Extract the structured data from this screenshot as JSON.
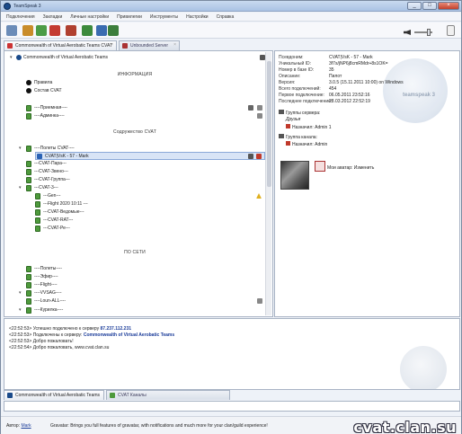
{
  "window": {
    "title": "TeamSpeak 3"
  },
  "menu": [
    "Подключения",
    "Закладки",
    "Личные настройки",
    "Привилегии",
    "Инструменты",
    "Настройки",
    "Справка"
  ],
  "tabs_top": [
    {
      "label": "Commonwealth of Virtual Aerobatic Teams  CVAT",
      "active": true
    },
    {
      "label": "Unbounded Server",
      "active": false
    }
  ],
  "tree": {
    "server": "Commonwealth of Virtual Aerobatic Teams",
    "sec_info": "ИНФОРМАЦИЯ",
    "info_items": [
      "Правила",
      "Состав CVAT"
    ],
    "channels_a": [
      "----Приемная----",
      "----Админка----"
    ],
    "sec_cvat": "Содружество CVAT",
    "channels_b": [
      "----Полеты CVAT----"
    ],
    "selected_user": "CVAT|VsK - 57 - Mark",
    "channels_c": [
      "---CVAT-Пара---",
      "---CVAT-Звено---",
      "---CVAT-Группа---",
      "---CVAT-3---",
      "---Gen---",
      "---Flight 2020 10:11 ---",
      "---CVAT-Ведомые---",
      "---CVAT-RAT---",
      "---CVAT-Ре---"
    ],
    "sec_online": "ПО СЕТИ",
    "channels_d": [
      "----Полеты----",
      "----Эфир----",
      "----Flight----",
      "----VVSAG----",
      "----Loun-ALL----",
      "----Курилка----"
    ]
  },
  "info": {
    "rows": [
      {
        "k": "Псевдоним:",
        "v": "CVAT|VsK - 57 - Mark"
      },
      {
        "k": "Уникальный ID:",
        "v": "3f7s/jNP6j8cmRMdr+8s1OK="
      },
      {
        "k": "Номер в базе ID:",
        "v": "35"
      },
      {
        "k": "Описание:",
        "v": "Пилот"
      },
      {
        "k": "Версия:",
        "v": "3.0.5 (15.11.2011 10:00) on Windows"
      },
      {
        "k": "Всего подключений:",
        "v": "454"
      },
      {
        "k": "Первое подключение:",
        "v": "06.05.2011 23:52:16"
      },
      {
        "k": "Последнее подключение:",
        "v": "28.03.2012 22:52:19"
      }
    ],
    "server_groups_label": "Группы сервера:",
    "server_group_value": "Друзья",
    "assigned_by_1": "Назначил: Admin 1",
    "channel_group_label": "Группа канала:",
    "assigned_by_2": "Назначил: Admin",
    "avatar_label": "Мои аватар: Изменить",
    "logo_text": "teamspeak 3"
  },
  "chat": [
    {
      "time": "<22:52:53>",
      "text": "Успешно подключено к серверу",
      "link": "87.237.112.231"
    },
    {
      "time": "<22:52:53>",
      "text": "Подключены к серверу:",
      "link": "Commonwealth of Virtual Aerobatic Teams"
    },
    {
      "time": "<22:52:53>",
      "text": "Добро пожаловать!",
      "link": ""
    },
    {
      "time": "<22:52:54>",
      "text": "Добро пожаловать, www.cvat.clan.su",
      "link": ""
    }
  ],
  "tabs_bottom": [
    {
      "label": "Commonwealth of Virtual Aerobatic Teams"
    },
    {
      "label": "CVAT Каналы"
    }
  ],
  "status": {
    "prefix": "Автор:",
    "author": "Mark",
    "message": "Gravatar: Brings you full features of gravatar, with notifications and much more for your clan/guild experience!"
  },
  "watermark": "cvat.clan.su"
}
